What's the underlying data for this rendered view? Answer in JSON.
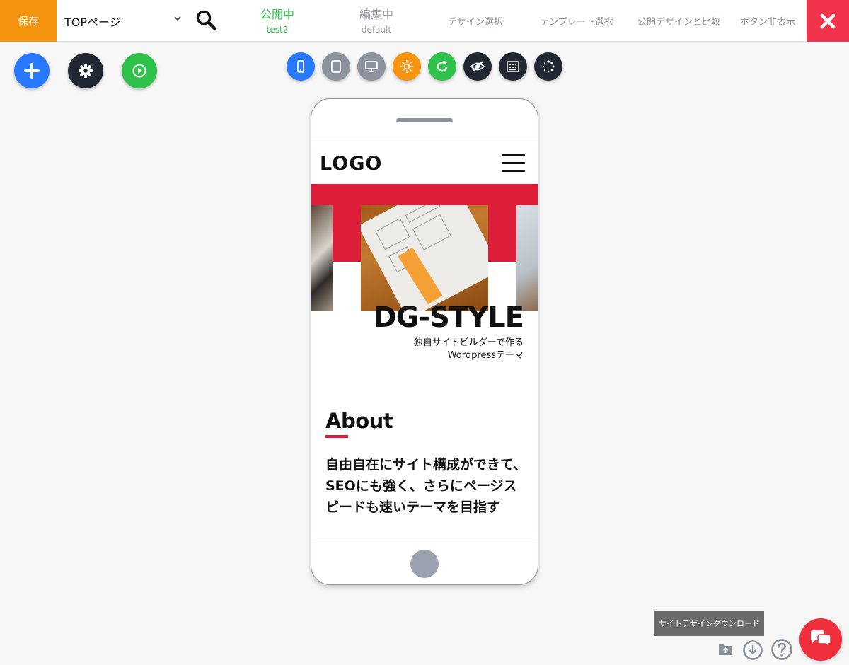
{
  "toolbar": {
    "save_label": "保存",
    "page_select_value": "TOPページ",
    "status_public": {
      "label": "公開中",
      "sub": "test2"
    },
    "status_editing": {
      "label": "編集中",
      "sub": "default"
    },
    "links": [
      "デザイン選択",
      "テンプレート選択",
      "公開デザインと比較",
      "ボタン非表示"
    ]
  },
  "colors": {
    "accent_orange": "#f5950f",
    "close_red": "#f0344b",
    "public_green": "#2fc24a",
    "brand_red": "#dc1e38",
    "blue": "#2979ff",
    "dark": "#222833"
  },
  "action_buttons": [
    "plus-icon",
    "gear-icon",
    "play-icon"
  ],
  "view_buttons": [
    "mobile-icon",
    "tablet-icon",
    "desktop-icon",
    "sun-icon",
    "refresh-icon",
    "eye-slash-icon",
    "keyboard-icon",
    "spinner-icon"
  ],
  "preview": {
    "logo": "LOGO",
    "brand_title": "DG-STYLE",
    "brand_sub_line1": "独自サイトビルダーで作る",
    "brand_sub_line2": "Wordpressテーマ",
    "about_title": "About",
    "about_body": "自由自在にサイト構成ができて、SEOにも強く、さらにページスピードも速いテーマを目指す"
  },
  "bottom": {
    "tooltip": "サイトデザインダウンロード",
    "icons": [
      "folder-upload-icon",
      "download-icon",
      "help-icon",
      "chat-icon"
    ]
  }
}
